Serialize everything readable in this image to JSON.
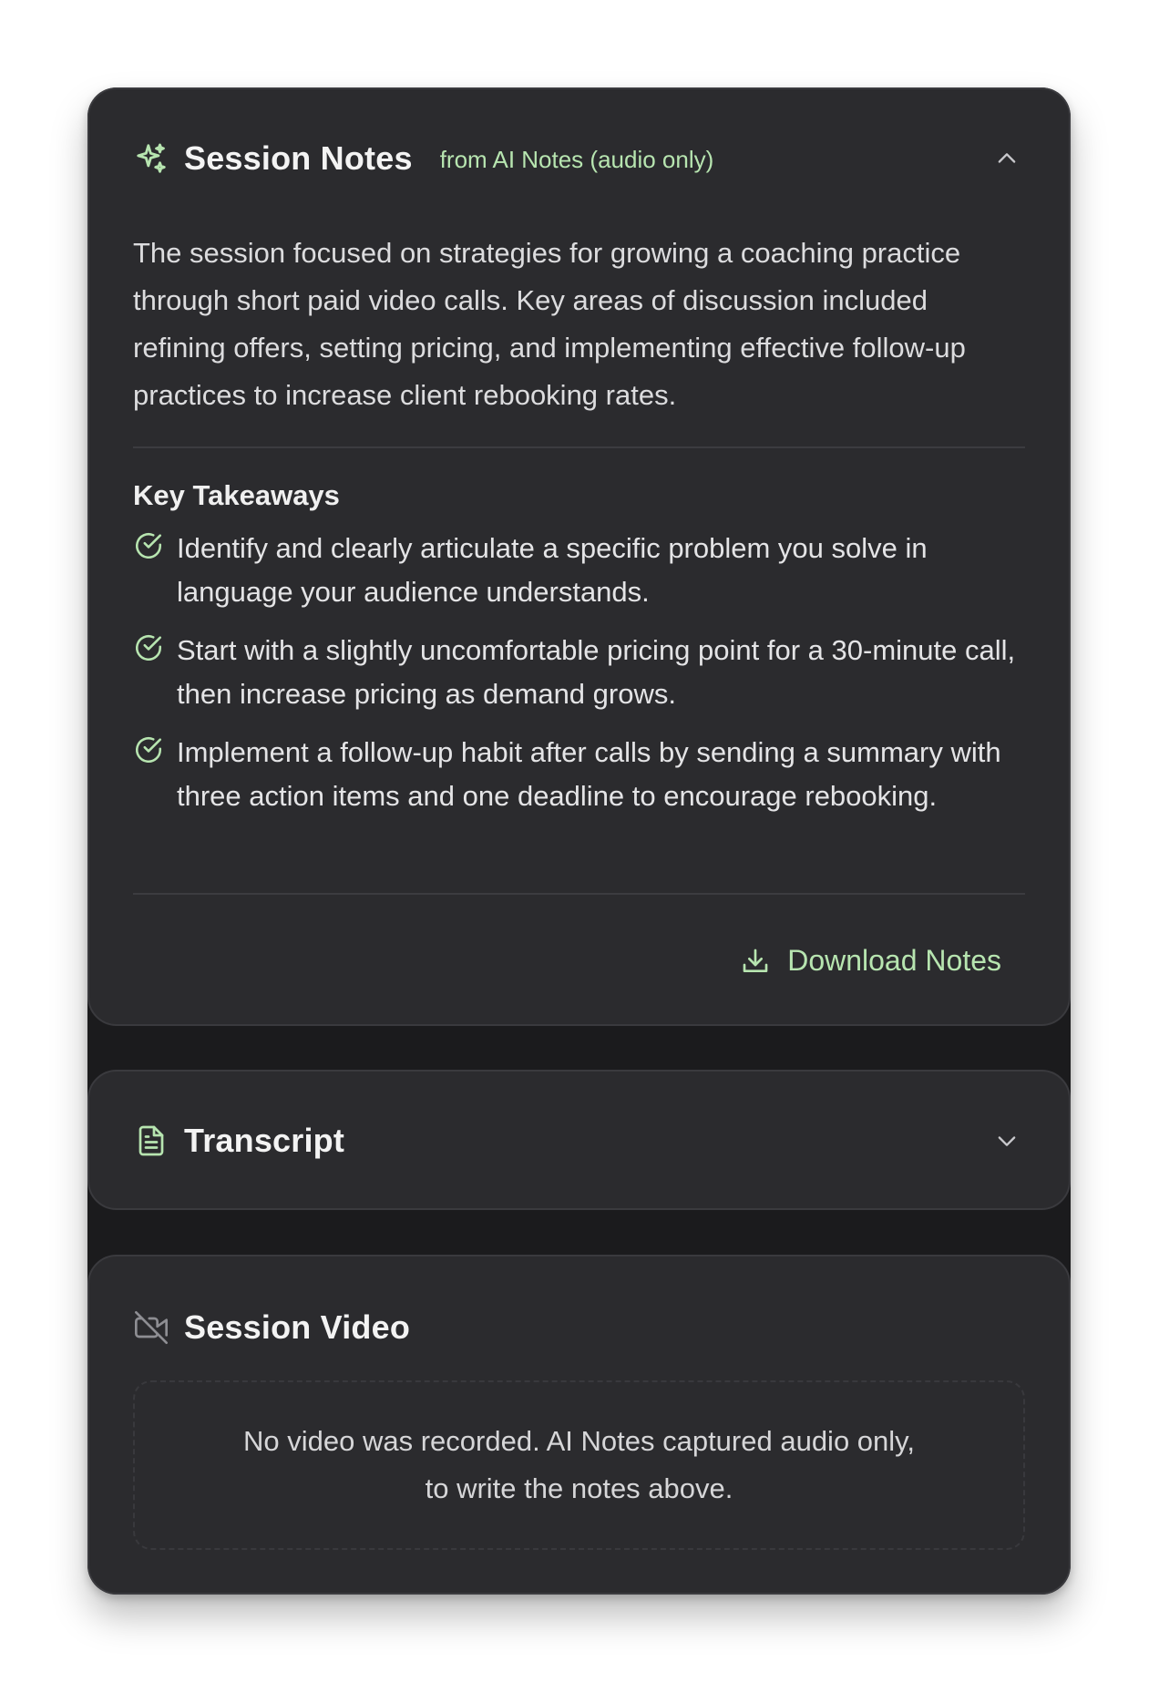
{
  "session_notes": {
    "title": "Session Notes",
    "source": "from AI Notes (audio only)",
    "icon": "sparkles-icon",
    "collapse_icon": "chevron-up-icon",
    "summary": "The session focused on strategies for growing a coaching practice through short paid video calls. Key areas of discussion included refining offers, setting pricing, and implementing effective follow-up practices to increase client rebooking rates.",
    "key_takeaways_title": "Key Takeaways",
    "key_takeaways": [
      "Identify and clearly articulate a specific problem you solve in language your audience understands.",
      "Start with a slightly uncomfortable pricing point for a 30-minute call, then increase pricing as demand grows.",
      "Implement a follow-up habit after calls by sending a summary with three action items and one deadline to encourage rebooking."
    ],
    "download_label": "Download Notes",
    "download_icon": "download-icon"
  },
  "transcript": {
    "title": "Transcript",
    "icon": "document-icon",
    "expand_icon": "chevron-down-icon"
  },
  "session_video": {
    "title": "Session Video",
    "icon": "video-off-icon",
    "message": "No video was recorded. AI Notes captured audio only, to write the notes above."
  },
  "colors": {
    "accent": "#b7e5b0",
    "card_bg": "#2b2b2e",
    "page_bg": "#1b1b1d",
    "text": "#dcdcde"
  }
}
